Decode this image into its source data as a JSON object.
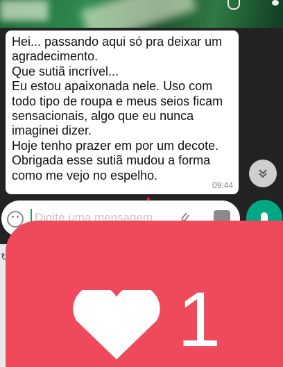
{
  "chat": {
    "message": {
      "text": "Hei... passando aqui só pra deixar um agradecimento.\nQue sutiã incrível...\nEu estou apaixonada nele. Uso com todo tipo de roupa e meus seios ficam sensacionais, algo que eu nunca imaginei dizer.\nHoje tenho prazer em por um decote.\nObrigada esse sutiã mudou a forma como me vejo no espelho.",
      "time": "09:44"
    },
    "scroll_down_icon": "double-chevron-down-icon"
  },
  "composer": {
    "placeholder": "Digite uma mensagem",
    "emoji_icon": "emoji-icon",
    "attach_icon": "paperclip-icon",
    "camera_icon": "camera-icon",
    "mic_icon": "mic-icon"
  },
  "like_overlay": {
    "count": "1",
    "heart_icon": "heart-icon",
    "color": "#ee4a5c"
  },
  "colors": {
    "send_button": "#00a884",
    "bubble": "#ffffff"
  }
}
